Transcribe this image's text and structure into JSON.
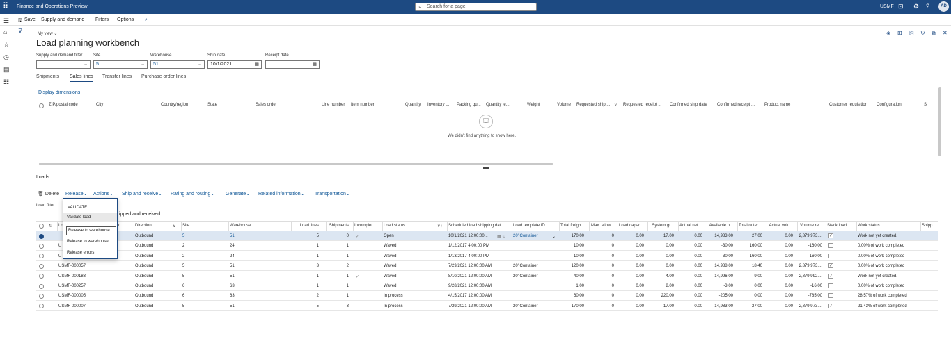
{
  "app": {
    "title": "Finance and Operations Preview",
    "search_placeholder": "Search for a page",
    "company": "USMF",
    "user_initials": "AD"
  },
  "actionbar": {
    "save": "Save",
    "supply_demand": "Supply and demand",
    "filters": "Filters",
    "options": "Options"
  },
  "page": {
    "view": "My view",
    "title": "Load planning workbench"
  },
  "filters": [
    {
      "label": "Supply and demand filter",
      "value": ""
    },
    {
      "label": "Site",
      "value": "5"
    },
    {
      "label": "Warehouse",
      "value": "51"
    },
    {
      "label": "Ship date",
      "value": "10/1/2021"
    },
    {
      "label": "Receipt date",
      "value": ""
    }
  ],
  "tabs": [
    "Shipments",
    "Sales lines",
    "Transfer lines",
    "Purchase order lines"
  ],
  "sales_lines": {
    "display_dimensions": "Display dimensions",
    "columns": [
      "ZIP/postal code",
      "City",
      "Country/region",
      "State",
      "Sales order",
      "Line number",
      "Item number",
      "Quantity",
      "Inventory ...",
      "Packing qu...",
      "Quantity le...",
      "Weight",
      "Volume",
      "Requested ship ...",
      "Requested receipt ...",
      "Confirmed ship date",
      "Confirmed receipt ...",
      "Product name",
      "Customer requisition",
      "Configuration",
      "S"
    ],
    "empty_message": "We didn't find anything to show here."
  },
  "loads": {
    "header": "Loads",
    "toolbar": [
      "Delete",
      "Release",
      "Actions",
      "Ship and receive",
      "Rating and routing",
      "Generate",
      "Related information",
      "Transportation"
    ],
    "load_filter_label": "Load filter",
    "load_filter_text": "ipped and received",
    "release_menu": {
      "heading": "VALIDATE",
      "items": [
        "Validate load",
        "Release to warehouse",
        "Release errors"
      ],
      "tooltip": "Release to warehouse"
    },
    "columns": [
      "Lo",
      "d",
      "Direction",
      "Site",
      "Warehouse",
      "Load lines",
      "Shipments",
      "Incomplet...",
      "Load status",
      "Scheduled load shipping dat...",
      "Load template ID",
      "Total freigh...",
      "Max. allow...",
      "Load capac...",
      "System gr...",
      "Actual net ...",
      "Available n...",
      "Total outer ...",
      "Actual volu...",
      "Volume re...",
      "Stack load ...",
      "Work status",
      "Shipp"
    ],
    "rows": [
      {
        "id": "",
        "direction": "Outbound",
        "site": "5",
        "warehouse": "51",
        "lines": "5",
        "shipments": "0",
        "incomplete": "✓",
        "status": "Open",
        "date": "10/1/2021 12:00:00...",
        "template": "20' Container",
        "freight": "170.00",
        "max": "0",
        "capacity": "0.00",
        "sysgr": "17.00",
        "actnet": "0.00",
        "avail": "14,983.00",
        "outer": "27.00",
        "actvol": "0.00",
        "volre": "2,879,973....",
        "stack": "✓",
        "work": "Work not yet created."
      },
      {
        "id": "U",
        "direction": "Outbound",
        "site": "2",
        "warehouse": "24",
        "lines": "1",
        "shipments": "1",
        "incomplete": "",
        "status": "Waved",
        "date": "1/12/2017 4:00:00 PM",
        "template": "",
        "freight": "10.00",
        "max": "0",
        "capacity": "0.00",
        "sysgr": "0.00",
        "actnet": "0.00",
        "avail": "-30.00",
        "outer": "160.00",
        "actvol": "0.00",
        "volre": "-160.00",
        "stack": "",
        "work": "0.00% of work completed"
      },
      {
        "id": "U",
        "direction": "Outbound",
        "site": "2",
        "warehouse": "24",
        "lines": "1",
        "shipments": "1",
        "incomplete": "",
        "status": "Waved",
        "date": "1/13/2017 4:00:00 PM",
        "template": "",
        "freight": "10.00",
        "max": "0",
        "capacity": "0.00",
        "sysgr": "0.00",
        "actnet": "0.00",
        "avail": "-30.00",
        "outer": "160.00",
        "actvol": "0.00",
        "volre": "-160.00",
        "stack": "",
        "work": "0.00% of work completed"
      },
      {
        "id": "USMF-000057",
        "direction": "Outbound",
        "site": "5",
        "warehouse": "51",
        "lines": "3",
        "shipments": "2",
        "incomplete": "",
        "status": "Waved",
        "date": "7/29/2021 12:00:00 AM",
        "template": "20' Container",
        "freight": "120.00",
        "max": "0",
        "capacity": "0.00",
        "sysgr": "0.00",
        "actnet": "0.00",
        "avail": "14,988.00",
        "outer": "18.40",
        "actvol": "0.00",
        "volre": "2,879,973....",
        "stack": "✓",
        "work": "0.00% of work completed"
      },
      {
        "id": "USMF-000183",
        "direction": "Outbound",
        "site": "5",
        "warehouse": "51",
        "lines": "1",
        "shipments": "1",
        "incomplete": "✓",
        "status": "Waved",
        "date": "8/10/2021 12:00:00 AM",
        "template": "20' Container",
        "freight": "40.00",
        "max": "0",
        "capacity": "0.00",
        "sysgr": "4.00",
        "actnet": "0.00",
        "avail": "14,996.00",
        "outer": "9.00",
        "actvol": "0.00",
        "volre": "2,879,992....",
        "stack": "✓",
        "work": "Work not yet created."
      },
      {
        "id": "USMF-000257",
        "direction": "Outbound",
        "site": "6",
        "warehouse": "63",
        "lines": "1",
        "shipments": "1",
        "incomplete": "",
        "status": "Waved",
        "date": "9/28/2021 12:00:00 AM",
        "template": "",
        "freight": "1.00",
        "max": "0",
        "capacity": "0.00",
        "sysgr": "8.00",
        "actnet": "0.00",
        "avail": "-3.00",
        "outer": "0.00",
        "actvol": "0.00",
        "volre": "-16.00",
        "stack": "",
        "work": "0.00% of work completed"
      },
      {
        "id": "USMF-000005",
        "direction": "Outbound",
        "site": "6",
        "warehouse": "63",
        "lines": "2",
        "shipments": "1",
        "incomplete": "",
        "status": "In process",
        "date": "4/15/2017 12:00:00 AM",
        "template": "",
        "freight": "60.00",
        "max": "0",
        "capacity": "0.00",
        "sysgr": "220.00",
        "actnet": "0.00",
        "avail": "-205.00",
        "outer": "0.00",
        "actvol": "0.00",
        "volre": "-785.00",
        "stack": "",
        "work": "28.57% of work completed"
      },
      {
        "id": "USMF-000007",
        "direction": "Outbound",
        "site": "5",
        "warehouse": "51",
        "lines": "5",
        "shipments": "3",
        "incomplete": "",
        "status": "In process",
        "date": "7/29/2021 12:00:00 AM",
        "template": "20' Container",
        "freight": "170.00",
        "max": "0",
        "capacity": "0.00",
        "sysgr": "17.00",
        "actnet": "0.00",
        "avail": "14,983.00",
        "outer": "27.00",
        "actvol": "0.00",
        "volre": "2,879,973....",
        "stack": "✓",
        "work": "21.43% of work completed"
      }
    ]
  }
}
